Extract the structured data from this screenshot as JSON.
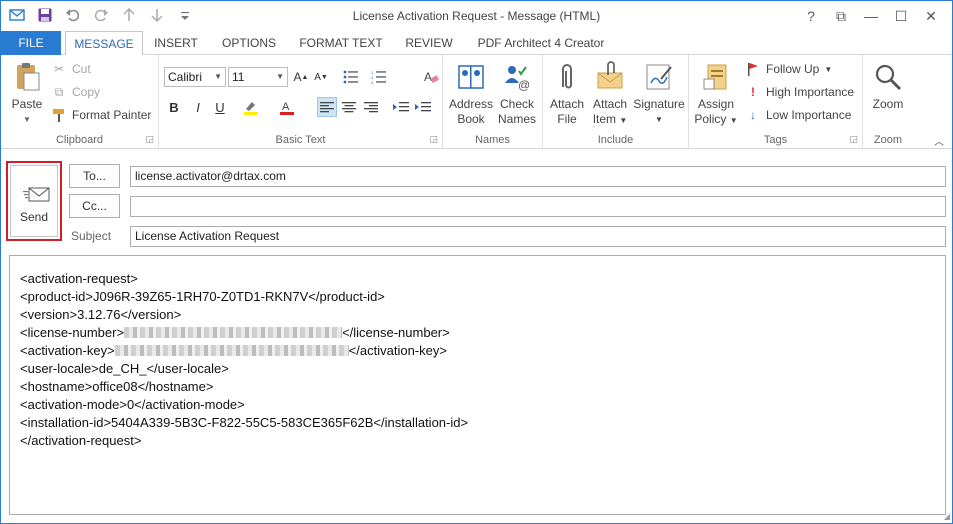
{
  "window": {
    "title": "License Activation Request - Message (HTML)",
    "accent": "#2a7bd2",
    "controls": [
      "?",
      "⧉",
      "—",
      "☐",
      "✕"
    ]
  },
  "qat": {
    "save_icon": "save-icon",
    "undo_icon": "undo-icon",
    "redo_icon": "redo-icon"
  },
  "tabs": [
    {
      "label": "FILE"
    },
    {
      "label": "MESSAGE"
    },
    {
      "label": "INSERT"
    },
    {
      "label": "OPTIONS"
    },
    {
      "label": "FORMAT TEXT"
    },
    {
      "label": "REVIEW"
    },
    {
      "label": "PDF Architect 4 Creator"
    }
  ],
  "ribbon": {
    "clipboard": {
      "label": "Clipboard",
      "paste": "Paste",
      "cut": "Cut",
      "copy": "Copy",
      "format_painter": "Format Painter"
    },
    "basic_text": {
      "label": "Basic Text",
      "font": "Calibri",
      "size": "11",
      "bold": "B",
      "italic": "I",
      "underline": "U"
    },
    "names": {
      "label": "Names",
      "address_book_1": "Address",
      "address_book_2": "Book",
      "check_names_1": "Check",
      "check_names_2": "Names"
    },
    "include": {
      "label": "Include",
      "attach_file_1": "Attach",
      "attach_file_2": "File",
      "attach_item_1": "Attach",
      "attach_item_2": "Item",
      "signature": "Signature"
    },
    "tags": {
      "label": "Tags",
      "assign_policy_1": "Assign",
      "assign_policy_2": "Policy",
      "follow_up": "Follow Up",
      "high_importance": "High Importance",
      "low_importance": "Low Importance"
    },
    "zoom": {
      "label": "Zoom",
      "zoom": "Zoom"
    }
  },
  "compose": {
    "send_label": "Send",
    "to_label": "To...",
    "cc_label": "Cc...",
    "subject_label": "Subject",
    "to_value": "license.activator@drtax.com",
    "cc_value": "",
    "subject_value": "License Activation Request"
  },
  "message_body": {
    "l1": "<activation-request>",
    "l2": "<product-id>J096R-39Z65-1RH70-Z0TD1-RKN7V</product-id>",
    "l3": "<version>3.12.76</version>",
    "l4_open": "<license-number>",
    "l4_close": "</license-number>",
    "l5_open": "<activation-key>",
    "l5_close": "</activation-key>",
    "l6": "<user-locale>de_CH_</user-locale>",
    "l7": "<hostname>office08</hostname>",
    "l8": "<activation-mode>0</activation-mode>",
    "l9": "<installation-id>5404A339-5B3C-F822-55C5-583CE365F62B</installation-id>",
    "l10": "</activation-request>"
  }
}
